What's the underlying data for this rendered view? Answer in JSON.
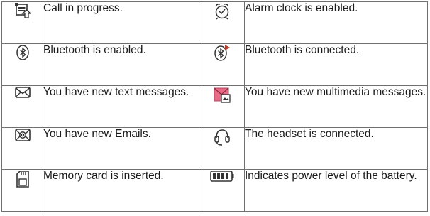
{
  "rows": [
    {
      "left": {
        "icon": "call-in-progress-icon",
        "text": "Call in progress."
      },
      "right": {
        "icon": "alarm-clock-icon",
        "text": "Alarm clock is enabled."
      }
    },
    {
      "left": {
        "icon": "bluetooth-icon",
        "text": "Bluetooth is enabled."
      },
      "right": {
        "icon": "bluetooth-connected-icon",
        "text": "Bluetooth is connected."
      }
    },
    {
      "left": {
        "icon": "text-message-icon",
        "text": "You have new text messages."
      },
      "right": {
        "icon": "multimedia-message-icon",
        "text": "You have new multimedia messages."
      }
    },
    {
      "left": {
        "icon": "email-icon",
        "text": "You have new Emails."
      },
      "right": {
        "icon": "headset-icon",
        "text": "The headset is connected."
      }
    },
    {
      "left": {
        "icon": "memory-card-icon",
        "text": "Memory card is inserted."
      },
      "right": {
        "icon": "battery-icon",
        "text": "Indicates power level of the battery."
      }
    }
  ],
  "colors": {
    "border": "#6f6f6f",
    "icon_stroke": "#333333",
    "mms_pink": "#e86b86",
    "bluetooth_accent": "#c0392b"
  }
}
